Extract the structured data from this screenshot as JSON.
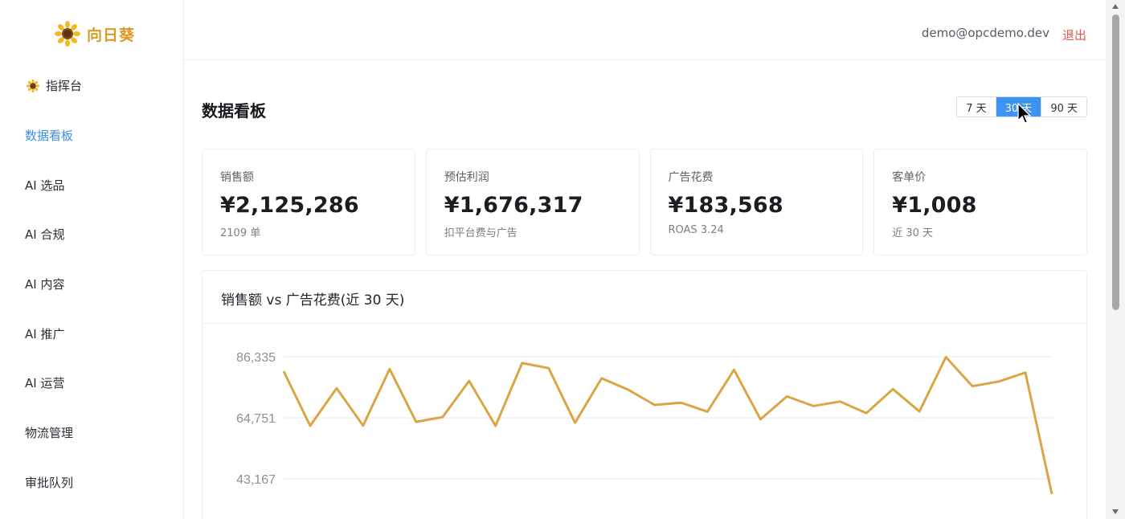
{
  "app": {
    "name": "向日葵",
    "logo_icon": "sunflower-icon",
    "brand_color": "#d99a28"
  },
  "sidebar": {
    "items": [
      {
        "label": "指挥台",
        "icon": "sunflower-icon"
      },
      {
        "label": "数据看板",
        "active": true
      },
      {
        "label": "AI 选品"
      },
      {
        "label": "AI 合规"
      },
      {
        "label": "AI 内容"
      },
      {
        "label": "AI 推广"
      },
      {
        "label": "AI 运营"
      },
      {
        "label": "物流管理"
      },
      {
        "label": "审批队列"
      }
    ],
    "active_color": "#3b8fe8"
  },
  "header": {
    "user_email": "demo@opcdemo.dev",
    "logout_label": "退出",
    "logout_color": "#e0574e"
  },
  "main": {
    "title": "数据看板",
    "range_options": [
      "7 天",
      "30 天",
      "90 天"
    ],
    "range_selected": "30 天",
    "cards": [
      {
        "label": "销售额",
        "value": "¥2,125,286",
        "sub": "2109 单"
      },
      {
        "label": "预估利润",
        "value": "¥1,676,317",
        "sub": "扣平台费与广告"
      },
      {
        "label": "广告花费",
        "value": "¥183,568",
        "sub": "ROAS 3.24"
      },
      {
        "label": "客单价",
        "value": "¥1,008",
        "sub": "近 30 天"
      }
    ]
  },
  "chart_data": {
    "type": "line",
    "title": "销售额 vs 广告花费(近 30 天)",
    "y_ticks": [
      "86,335",
      "64,751",
      "43,167"
    ],
    "ylim": [
      30000,
      86335
    ],
    "grid": true,
    "series": [
      {
        "color": "#dba546",
        "values": [
          81200,
          61900,
          75200,
          62000,
          82000,
          63300,
          65000,
          77800,
          61900,
          84100,
          82300,
          63000,
          78700,
          74700,
          69300,
          70100,
          66900,
          81700,
          64200,
          72300,
          68900,
          70500,
          66400,
          74900,
          67000,
          86200,
          75900,
          77600,
          80700,
          37800
        ]
      }
    ]
  }
}
